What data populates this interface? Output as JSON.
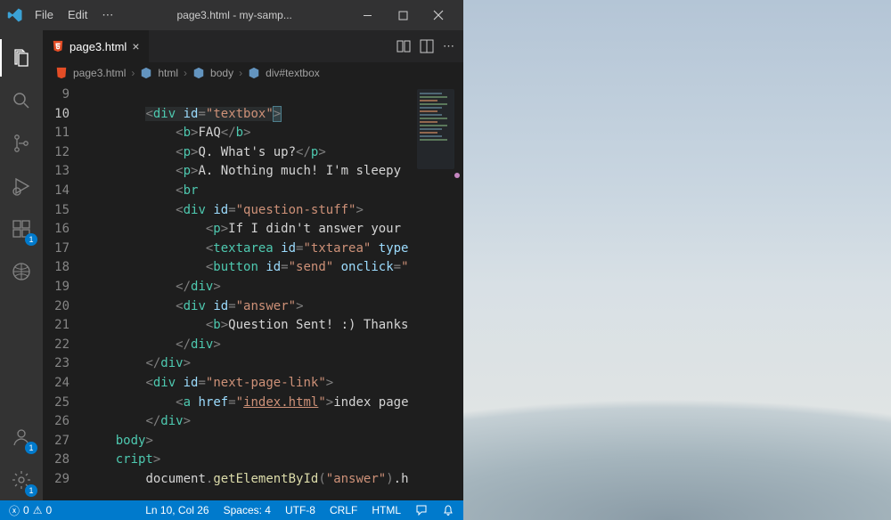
{
  "window": {
    "title": "page3.html - my-samp..."
  },
  "menu": {
    "file": "File",
    "edit": "Edit"
  },
  "tab": {
    "name": "page3.html"
  },
  "breadcrumbs": {
    "file": "page3.html",
    "node1": "html",
    "node2": "body",
    "node3": "div#textbox"
  },
  "activity": {
    "extensions_badge": "1",
    "account_badge": "1",
    "settings_badge": "1"
  },
  "tab_actions": {
    "split_icon": "split-editor",
    "layout_icon": "layout-icon",
    "more_icon": "more-icon"
  },
  "code": {
    "lines": [
      {
        "n": "9",
        "content": ""
      },
      {
        "n": "10",
        "content_a": "<div id=\"textbox\"",
        "content_b": ">"
      },
      {
        "n": "11",
        "tag": "b",
        "text": "FAQ"
      },
      {
        "n": "12",
        "tag": "p",
        "text": "Q. What's up?"
      },
      {
        "n": "13",
        "tag": "p",
        "text": "A. Nothing much! I'm sleepy"
      },
      {
        "n": "14",
        "tag": "br"
      },
      {
        "n": "15",
        "tag": "div",
        "attrs": "id=\"question-stuff\""
      },
      {
        "n": "16",
        "tag": "p",
        "text": "If I didn't answer your"
      },
      {
        "n": "17",
        "tag": "textarea",
        "attrs": "id=\"txtarea\" type"
      },
      {
        "n": "18",
        "tag": "button",
        "attrs": "id=\"send\" onclick=\""
      },
      {
        "n": "19",
        "close": "div"
      },
      {
        "n": "20",
        "tag": "div",
        "attrs": "id=\"answer\""
      },
      {
        "n": "21",
        "tag": "b",
        "text": "Question Sent! :) Thanks"
      },
      {
        "n": "22",
        "close": "div"
      },
      {
        "n": "23",
        "close": "div"
      },
      {
        "n": "24",
        "tag": "div",
        "attrs": "id=\"next-page-link\""
      },
      {
        "n": "25",
        "tag": "a",
        "href": "index.html",
        "text": "index page"
      },
      {
        "n": "26",
        "close": "div"
      },
      {
        "n": "27",
        "close_bare": "body>"
      },
      {
        "n": "28",
        "close_bare": "cript>"
      },
      {
        "n": "29",
        "script": {
          "obj": "document",
          "fn": "getElementById",
          "arg": "\"answer\"",
          "tail": ".h"
        }
      }
    ]
  },
  "status": {
    "errors": "0",
    "warnings": "0",
    "cursor": "Ln 10, Col 26",
    "spaces": "Spaces: 4",
    "encoding": "UTF-8",
    "eol": "CRLF",
    "lang": "HTML"
  }
}
